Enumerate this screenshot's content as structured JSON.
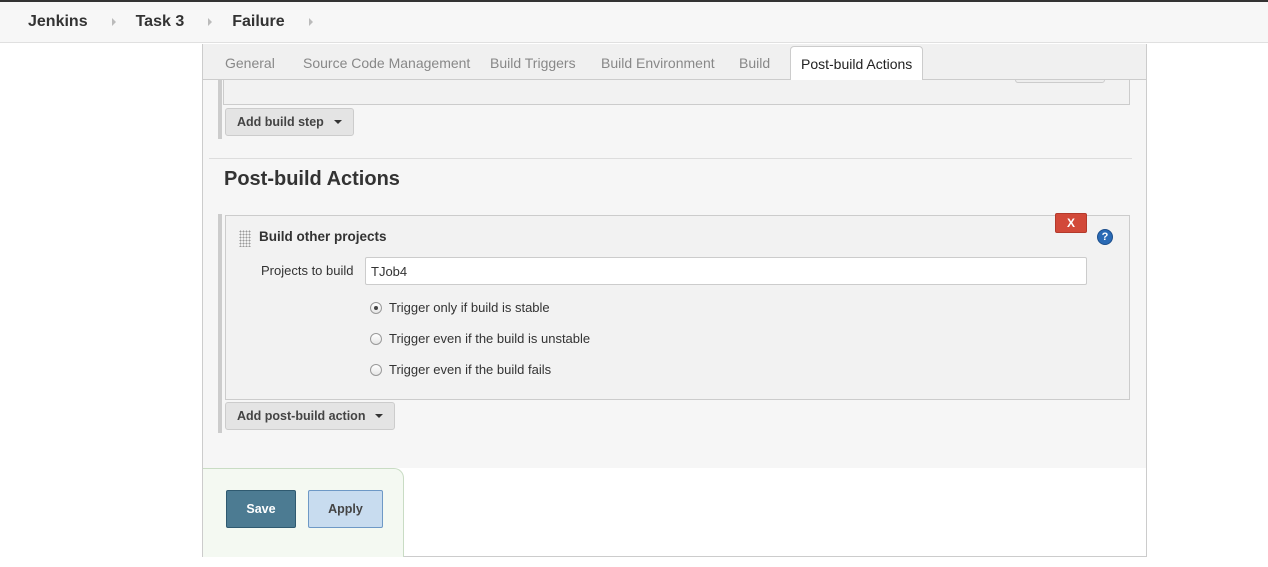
{
  "breadcrumb": {
    "items": [
      "Jenkins",
      "Task 3",
      "Failure"
    ]
  },
  "tabs": [
    {
      "label": "General",
      "active": false
    },
    {
      "label": "Source Code Management",
      "active": false
    },
    {
      "label": "Build Triggers",
      "active": false
    },
    {
      "label": "Build Environment",
      "active": false
    },
    {
      "label": "Build",
      "active": false
    },
    {
      "label": "Post-build Actions",
      "active": true
    }
  ],
  "build": {
    "add_build_step_label": "Add build step"
  },
  "post_build": {
    "section_title": "Post-build Actions",
    "action": {
      "title": "Build other projects",
      "delete_label": "X",
      "help_label": "?",
      "projects_label": "Projects to build",
      "projects_value": "TJob4",
      "trigger_options": [
        {
          "label": "Trigger only if build is stable",
          "checked": true
        },
        {
          "label": "Trigger even if the build is unstable",
          "checked": false
        },
        {
          "label": "Trigger even if the build fails",
          "checked": false
        }
      ]
    },
    "add_action_label": "Add post-build action"
  },
  "footer": {
    "save_label": "Save",
    "apply_label": "Apply"
  },
  "colors": {
    "save_button": "#4c7b92",
    "apply_button": "#c8dcef",
    "delete_button": "#d24939",
    "help_icon": "#2a6ab5"
  }
}
